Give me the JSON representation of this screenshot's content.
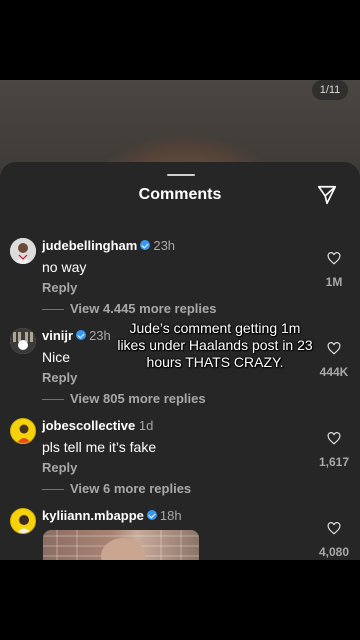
{
  "photo": {
    "counter": "1/11"
  },
  "sheet": {
    "title": "Comments",
    "send_icon": "send-icon"
  },
  "overlay_caption": "Jude’s comment getting 1m likes under Haalands post in 23 hours THATS CRAZY.",
  "comments": [
    {
      "username": "judebellingham",
      "verified": true,
      "time": "23h",
      "text": "no way",
      "reply_label": "Reply",
      "view_replies": "View 4.445 more replies",
      "likes": "1M",
      "avatar_color": "#d9d9d9"
    },
    {
      "username": "vinijr",
      "verified": true,
      "time": "23h",
      "text": "Nice",
      "reply_label": "Reply",
      "view_replies": "View 805 more replies",
      "likes": "444K",
      "avatar_color": "#c9c0b4"
    },
    {
      "username": "jobescollective",
      "verified": false,
      "time": "1d",
      "text": "pls tell me it’s fake",
      "reply_label": "Reply",
      "view_replies": "View 6 more replies",
      "likes": "1,617",
      "avatar_color": "#f5d20a"
    },
    {
      "username": "kyliiann.mbappe",
      "verified": true,
      "time": "18h",
      "text": "",
      "likes": "4,080",
      "avatar_color": "#f5d20a"
    }
  ],
  "colors": {
    "sheet_bg": "#262626",
    "secondary_text": "#a8a8a8",
    "verified_blue": "#3897f0"
  }
}
